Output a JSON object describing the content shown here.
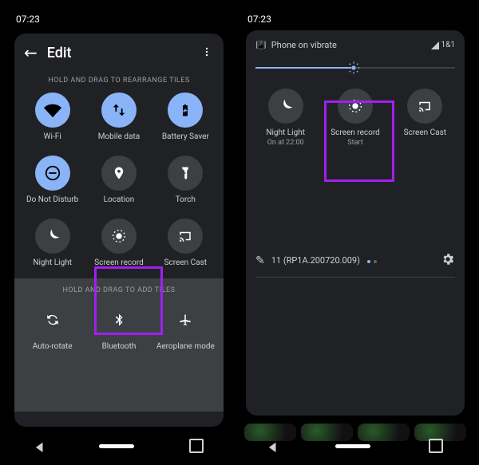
{
  "left": {
    "time": "07:23",
    "header": {
      "title": "Edit"
    },
    "hint_rearrange": "HOLD AND DRAG TO REARRANGE TILES",
    "tiles": {
      "wifi": "Wi-Fi",
      "mobile": "Mobile data",
      "battery": "Battery Saver",
      "dnd": "Do Not Disturb",
      "location": "Location",
      "torch": "Torch",
      "night": "Night Light",
      "record": "Screen record",
      "cast": "Screen Cast"
    },
    "hint_add": "HOLD AND DRAG TO ADD TILES",
    "addTiles": {
      "rotate": "Auto-rotate",
      "bt": "Bluetooth",
      "air": "Aeroplane mode"
    }
  },
  "right": {
    "time": "07:23",
    "vibrate": "Phone on vibrate",
    "carrier": "1&1",
    "tiles": {
      "night": {
        "label": "Night Light",
        "sub": "On at 22:00"
      },
      "record": {
        "label": "Screen record",
        "sub": "Start"
      },
      "cast": {
        "label": "Screen Cast"
      }
    },
    "version": "11 (RP1A.200720.009)"
  },
  "colors": {
    "accent": "#8ab4f8",
    "highlight": "#a020f0"
  }
}
